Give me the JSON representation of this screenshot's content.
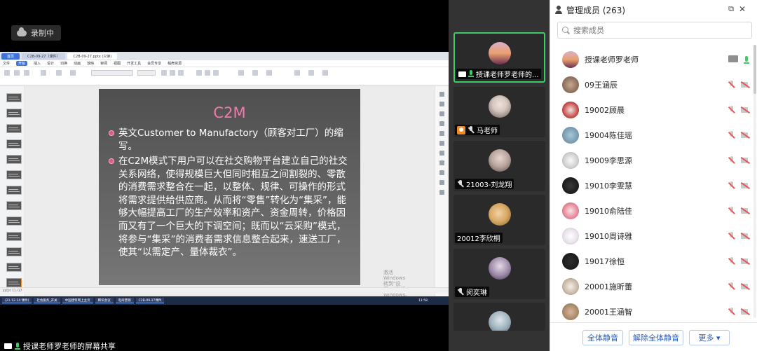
{
  "recording": {
    "label": "录制中"
  },
  "share_label": "授课老师罗老师的屏幕共享",
  "wps": {
    "tabs": [
      "首页",
      "C2B-09-27（课件）",
      "C2B-09-27.pptx (只读)"
    ],
    "menu": [
      "文件",
      "开始",
      "插入",
      "设计",
      "切换",
      "动画",
      "放映",
      "审阅",
      "视图",
      "开发工具",
      "会员专享",
      "稻壳资源"
    ],
    "status_left": "幻灯片 11 / 27",
    "taskbar": [
      "(21-12-14 课件)",
      "社会服务_开关",
      "中国建筑网上主页",
      "腾讯会议",
      "电商营销",
      "C2B-09-27课件"
    ],
    "clock": "11:58"
  },
  "slide": {
    "title": "C2M",
    "bullets": [
      "英文Customer to Manufactory（顾客对工厂）的缩写。",
      "在C2M模式下用户可以在社交购物平台建立自己的社交关系网络，使得规模巨大但同时相互之间割裂的、零散的消费需求整合在一起，以整体、规律、可操作的形式将需求提供给供应商。从而将“零售”转化为“集采”，能够大幅提高工厂的生产效率和资产、资金周转，价格因而又有了一个巨大的下调空间；既而以“云采购”模式，将参与“集采”的消费者需求信息整合起来，速送工厂，使其“以需定产、量体裁衣”。"
    ],
    "watermark": [
      "激活 Windows",
      "转到\"设置\"以激活 Windows。"
    ]
  },
  "video_tiles": [
    {
      "name": "授课老师罗老师的...",
      "active": true,
      "icon": "screen-share"
    },
    {
      "name": "马老师",
      "active": false,
      "icon": "host"
    },
    {
      "name": "21003-刘龙翔",
      "active": false,
      "icon": "mic-off"
    },
    {
      "name": "20012李欣桐",
      "active": false,
      "icon": "none"
    },
    {
      "name": "闵奕琳",
      "active": false,
      "icon": "mic-off"
    },
    {
      "name": "",
      "active": false,
      "icon": "none"
    }
  ],
  "panel": {
    "title": "管理成员 (263)",
    "search_placeholder": "搜索成员",
    "members": [
      {
        "name": "授课老师罗老师",
        "mic": "on",
        "cam": "screen"
      },
      {
        "name": "09王涵辰",
        "mic": "off",
        "cam": "off"
      },
      {
        "name": "19002顾晨",
        "mic": "off",
        "cam": "off"
      },
      {
        "name": "19004陈佳瑶",
        "mic": "off",
        "cam": "off"
      },
      {
        "name": "19009李思源",
        "mic": "off",
        "cam": "off"
      },
      {
        "name": "19010李雯慧",
        "mic": "off",
        "cam": "off"
      },
      {
        "name": "19010俞陆佳",
        "mic": "off",
        "cam": "off"
      },
      {
        "name": "19010周诗雅",
        "mic": "off",
        "cam": "off"
      },
      {
        "name": "19017徐恒",
        "mic": "off",
        "cam": "off"
      },
      {
        "name": "20001施昕蕾",
        "mic": "off",
        "cam": "off"
      },
      {
        "name": "20001王涵智",
        "mic": "off",
        "cam": "off"
      }
    ],
    "buttons": {
      "mute_all": "全体静音",
      "unmute_all": "解除全体静音",
      "more": "更多 ▾"
    }
  }
}
